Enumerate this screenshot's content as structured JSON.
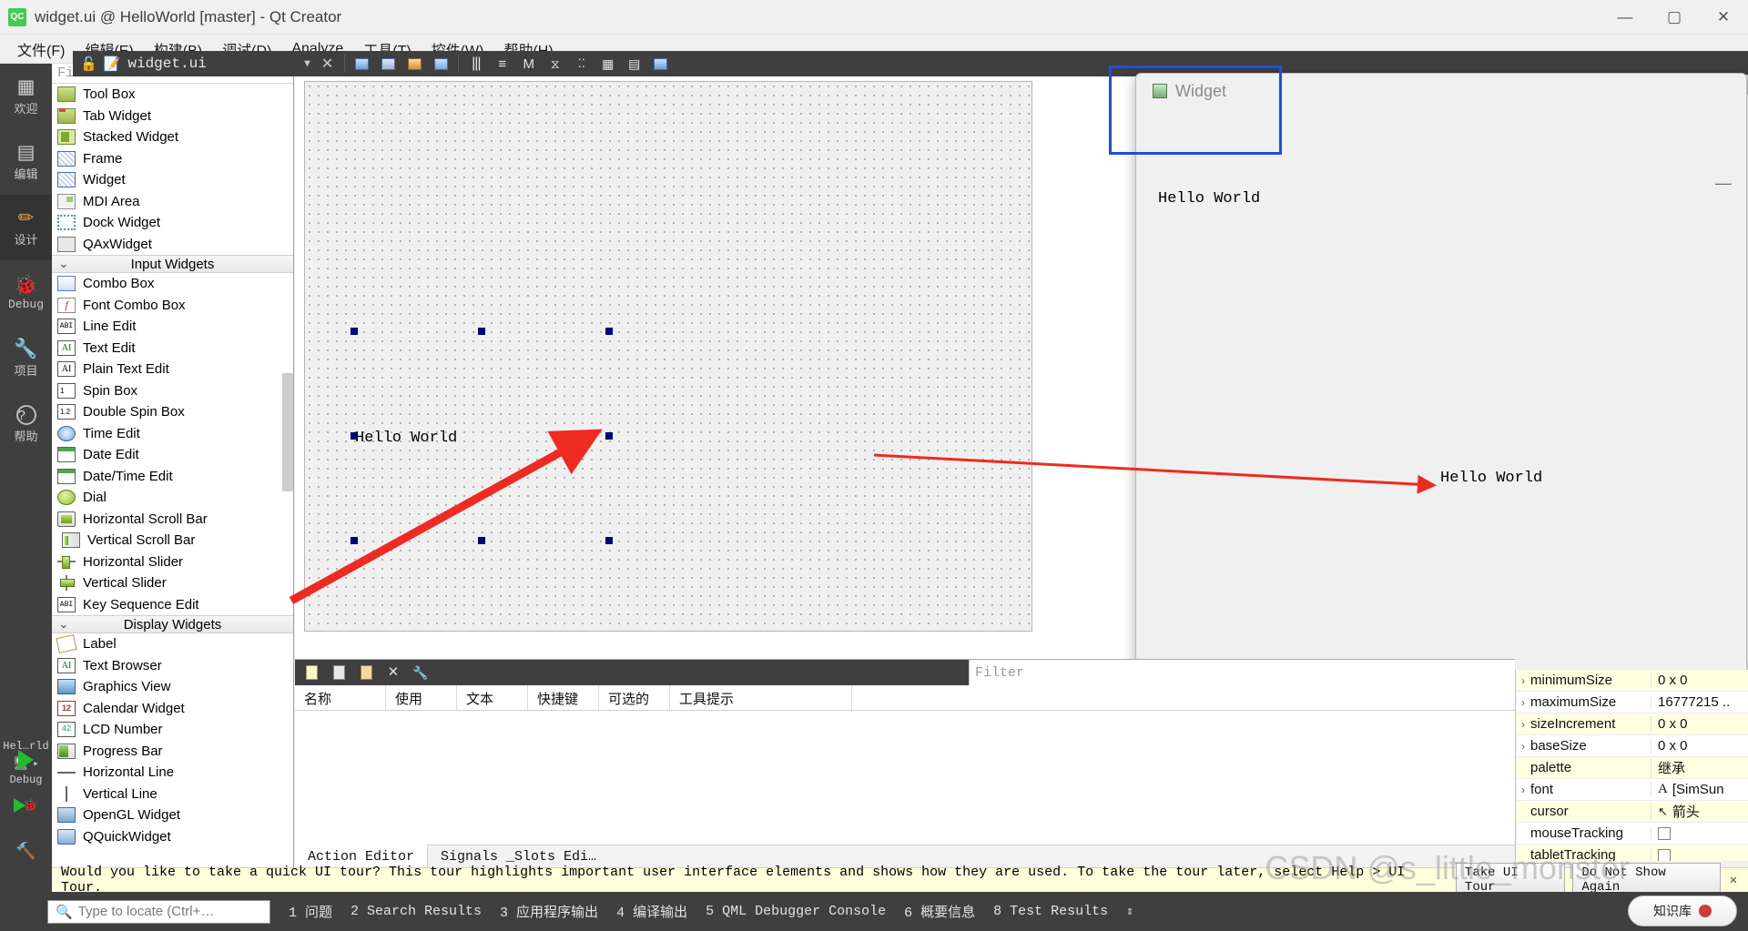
{
  "window": {
    "title": "widget.ui @ HelloWorld [master] - Qt Creator",
    "logo_text": "QC",
    "minimize": "—",
    "maximize": "▢",
    "close": "✕"
  },
  "menubar": [
    {
      "label": "文件(F)"
    },
    {
      "label": "编辑(E)"
    },
    {
      "label": "构建(B)"
    },
    {
      "label": "调试(D)"
    },
    {
      "label": "Analyze"
    },
    {
      "label": "工具(T)"
    },
    {
      "label": "控件(W)"
    },
    {
      "label": "帮助(H)"
    }
  ],
  "modebar": [
    {
      "label": "欢迎",
      "icon": "grid-icon",
      "glyph": "▦",
      "active": false
    },
    {
      "label": "编辑",
      "icon": "document-icon",
      "glyph": "▤",
      "active": false
    },
    {
      "label": "设计",
      "icon": "pencil-icon",
      "glyph": "✏",
      "active": true
    },
    {
      "label": "Debug",
      "icon": "bug-icon",
      "glyph": "🐞",
      "active": false
    },
    {
      "label": "项目",
      "icon": "wrench-icon",
      "glyph": "🔧",
      "active": false
    },
    {
      "label": "帮助",
      "icon": "question-icon",
      "glyph": "?",
      "active": false
    }
  ],
  "kit_selector": {
    "label": "Hel…rld",
    "mode": "Debug"
  },
  "document_tab": {
    "filename": "widget.ui",
    "lock_icon": "unlocked-icon",
    "file_icon": "ui-file-icon",
    "dropdown_icon": "chevron-down-icon",
    "close_icon": "close-icon"
  },
  "designer_toolbar": [
    {
      "name": "edit-widgets-icon"
    },
    {
      "name": "edit-signals-slots-icon"
    },
    {
      "name": "edit-buddies-icon"
    },
    {
      "name": "edit-tab-order-icon"
    },
    {
      "name": "layout-horizontally-icon"
    },
    {
      "name": "layout-vertically-icon"
    },
    {
      "name": "layout-splitter-h-icon"
    },
    {
      "name": "layout-splitter-v-icon"
    },
    {
      "name": "layout-form-icon"
    },
    {
      "name": "layout-grid-icon"
    },
    {
      "name": "break-layout-icon"
    },
    {
      "name": "adjust-size-icon"
    }
  ],
  "widget_box": {
    "filter_placeholder": "Filter",
    "groups": [
      {
        "header": null,
        "items": [
          {
            "label": "Tool Box",
            "icon": "toolbox-icon",
            "cls": "ic-toolbox"
          },
          {
            "label": "Tab Widget",
            "icon": "tab-widget-icon",
            "cls": "ic-tab"
          },
          {
            "label": "Stacked Widget",
            "icon": "stacked-widget-icon",
            "cls": "ic-stack"
          },
          {
            "label": "Frame",
            "icon": "frame-icon",
            "cls": "ic-frame"
          },
          {
            "label": "Widget",
            "icon": "widget-icon",
            "cls": "ic-frame"
          },
          {
            "label": "MDI Area",
            "icon": "mdi-area-icon",
            "cls": "ic-mdi"
          },
          {
            "label": "Dock Widget",
            "icon": "dock-widget-icon",
            "cls": "ic-dock"
          },
          {
            "label": "QAxWidget",
            "icon": "qax-widget-icon",
            "cls": "ic-qax"
          }
        ]
      },
      {
        "header": "Input Widgets",
        "items": [
          {
            "label": "Combo Box",
            "icon": "combo-box-icon",
            "cls": "ic-combo"
          },
          {
            "label": "Font Combo Box",
            "icon": "font-combo-box-icon",
            "cls": "ic-fcombo",
            "text": "f"
          },
          {
            "label": "Line Edit",
            "icon": "line-edit-icon",
            "cls": "ic-line",
            "text": "ABI"
          },
          {
            "label": "Text Edit",
            "icon": "text-edit-icon",
            "cls": "ic-text",
            "text": "AI"
          },
          {
            "label": "Plain Text Edit",
            "icon": "plain-text-edit-icon",
            "cls": "ic-ptext",
            "text": "AI"
          },
          {
            "label": "Spin Box",
            "icon": "spin-box-icon",
            "cls": "ic-spin",
            "text": "1"
          },
          {
            "label": "Double Spin Box",
            "icon": "double-spin-box-icon",
            "cls": "ic-spin",
            "text": "1.2"
          },
          {
            "label": "Time Edit",
            "icon": "time-edit-icon",
            "cls": "ic-time"
          },
          {
            "label": "Date Edit",
            "icon": "date-edit-icon",
            "cls": "ic-date"
          },
          {
            "label": "Date/Time Edit",
            "icon": "date-time-edit-icon",
            "cls": "ic-date"
          },
          {
            "label": "Dial",
            "icon": "dial-icon",
            "cls": "ic-dial"
          },
          {
            "label": "Horizontal Scroll Bar",
            "icon": "horizontal-scroll-bar-icon",
            "cls": "ic-hscroll"
          },
          {
            "label": "Vertical Scroll Bar",
            "icon": "vertical-scroll-bar-icon",
            "cls": "ic-vscroll"
          },
          {
            "label": "Horizontal Slider",
            "icon": "horizontal-slider-icon",
            "cls": "ic-hslider"
          },
          {
            "label": "Vertical Slider",
            "icon": "vertical-slider-icon",
            "cls": "ic-vslider"
          },
          {
            "label": "Key Sequence Edit",
            "icon": "key-sequence-edit-icon",
            "cls": "ic-line",
            "text": "ABI"
          }
        ]
      },
      {
        "header": "Display Widgets",
        "items": [
          {
            "label": "Label",
            "icon": "label-icon",
            "cls": "ic-label"
          },
          {
            "label": "Text Browser",
            "icon": "text-browser-icon",
            "cls": "ic-text",
            "text": "AI"
          },
          {
            "label": "Graphics View",
            "icon": "graphics-view-icon",
            "cls": "ic-gview"
          },
          {
            "label": "Calendar Widget",
            "icon": "calendar-widget-icon",
            "cls": "ic-cal",
            "text": "12"
          },
          {
            "label": "LCD Number",
            "icon": "lcd-number-icon",
            "cls": "ic-lcd",
            "text": "42"
          },
          {
            "label": "Progress Bar",
            "icon": "progress-bar-icon",
            "cls": "ic-prog"
          },
          {
            "label": "Horizontal Line",
            "icon": "horizontal-line-icon",
            "cls": "ic-hline"
          },
          {
            "label": "Vertical Line",
            "icon": "vertical-line-icon",
            "cls": "ic-vline"
          },
          {
            "label": "OpenGL Widget",
            "icon": "opengl-widget-icon",
            "cls": "ic-ogl"
          },
          {
            "label": "QQuickWidget",
            "icon": "qquick-widget-icon",
            "cls": "ic-qq"
          }
        ]
      }
    ]
  },
  "canvas": {
    "label_text": "Hello World",
    "selection_handles": 8
  },
  "preview": {
    "title": "Widget",
    "icon": "widget-window-icon",
    "hello_text": "Hello World",
    "minimize": "—"
  },
  "right_filter_placeholder": "Filter",
  "action_editor": {
    "toolbar": [
      {
        "name": "new-action-icon"
      },
      {
        "name": "copy-action-icon"
      },
      {
        "name": "paste-action-icon"
      },
      {
        "name": "delete-action-icon"
      },
      {
        "name": "configure-icon"
      }
    ],
    "filter_placeholder": "Filter",
    "columns": [
      "名称",
      "使用",
      "文本",
      "快捷键",
      "可选的",
      "工具提示"
    ],
    "tabs": [
      {
        "label": "Action Editor",
        "active": true
      },
      {
        "label": "Signals _Slots Edi…",
        "active": false
      }
    ]
  },
  "property_editor": {
    "rows": [
      {
        "name": "minimumSize",
        "value": "0 x 0",
        "expandable": true,
        "alt": true,
        "kind": "text"
      },
      {
        "name": "maximumSize",
        "value": "16777215 ..",
        "expandable": true,
        "alt": false,
        "kind": "text"
      },
      {
        "name": "sizeIncrement",
        "value": "0 x 0",
        "expandable": true,
        "alt": true,
        "kind": "text"
      },
      {
        "name": "baseSize",
        "value": "0 x 0",
        "expandable": true,
        "alt": false,
        "kind": "text"
      },
      {
        "name": "palette",
        "value": "继承",
        "expandable": false,
        "alt": true,
        "kind": "text"
      },
      {
        "name": "font",
        "value": "[SimSun",
        "expandable": true,
        "alt": false,
        "kind": "font"
      },
      {
        "name": "cursor",
        "value": "箭头",
        "expandable": false,
        "alt": true,
        "kind": "cursor"
      },
      {
        "name": "mouseTracking",
        "value": "",
        "expandable": false,
        "alt": false,
        "kind": "checkbox"
      },
      {
        "name": "tabletTracking",
        "value": "",
        "expandable": false,
        "alt": true,
        "kind": "checkbox"
      }
    ]
  },
  "tour_bar": {
    "message": "Would you like to take a quick UI tour? This tour highlights important user interface elements and shows how they are used. To take the tour later, select Help > UI Tour.",
    "take_tour": "Take UI Tour",
    "do_not_show": "Do Not Show Again",
    "close": "✕"
  },
  "statusbar": {
    "locate_placeholder": "Type to locate (Ctrl+…",
    "search_icon": "search-icon",
    "items": [
      "1 问题",
      "2 Search Results",
      "3 应用程序输出",
      "4 编译输出",
      "5 QML Debugger Console",
      "6 概要信息",
      "8 Test Results"
    ],
    "updown_icon": "updown-arrows-icon",
    "progress_label": "知识库"
  },
  "watermark": "CSDN @s_little_monster",
  "colors": {
    "accent_blue": "#1f4fd8",
    "arrow_red": "#ee2b20",
    "mode_active": "#333333",
    "dark_chrome": "#3f3f3f",
    "tour_bg": "#ffffdc",
    "prop_alt": "#ffffe1",
    "handle": "#000080"
  }
}
